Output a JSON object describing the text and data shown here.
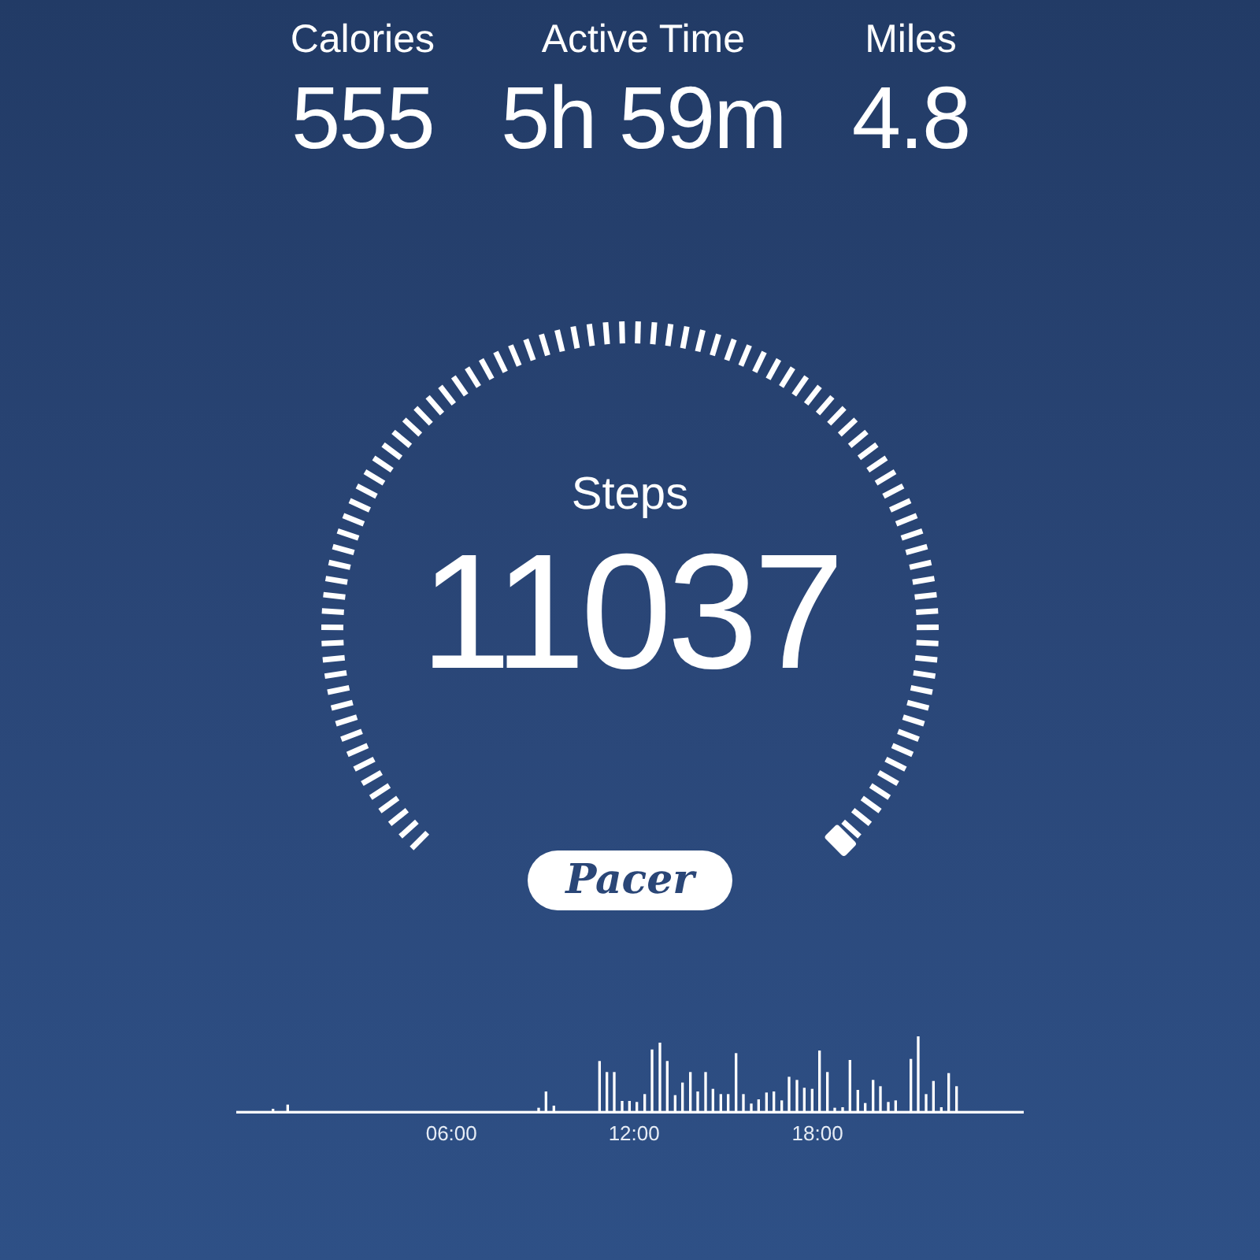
{
  "stats": [
    {
      "label": "Calories",
      "value": "555"
    },
    {
      "label": "Active Time",
      "value": "5h 59m"
    },
    {
      "label": "Miles",
      "value": "4.8"
    }
  ],
  "gauge": {
    "label": "Steps",
    "value": "11037"
  },
  "logo": "Pacer",
  "time_labels": [
    "06:00",
    "12:00",
    "18:00"
  ]
}
